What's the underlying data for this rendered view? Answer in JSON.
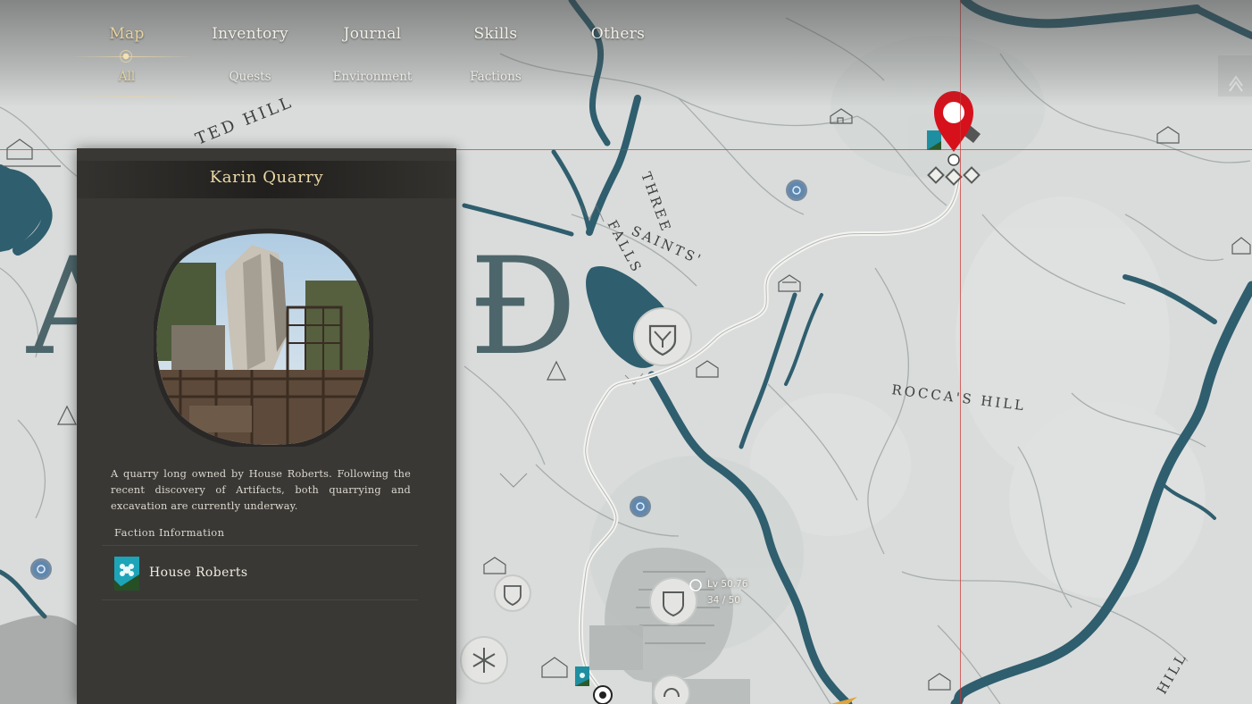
{
  "nav": {
    "tabs": [
      {
        "label": "Map",
        "active": true
      },
      {
        "label": "Inventory",
        "active": false
      },
      {
        "label": "Journal",
        "active": false
      },
      {
        "label": "Skills",
        "active": false
      },
      {
        "label": "Others",
        "active": false
      }
    ],
    "subtabs": [
      {
        "label": "All",
        "active": true
      },
      {
        "label": "Quests",
        "active": false
      },
      {
        "label": "Environment",
        "active": false
      },
      {
        "label": "Factions",
        "active": false
      }
    ]
  },
  "map_labels": {
    "hill_1": "TED HILL",
    "falls_1": "THREE",
    "falls_2": "SAINTS'",
    "falls_3": "FALLS",
    "roccas_hill": "ROCCA'S HILL",
    "hill_2": "HILL",
    "big_letter_left": "A",
    "big_letter_right": "Đ"
  },
  "panel": {
    "title": "Karin Quarry",
    "description": "A quarry long owned by House Roberts. Following the recent discovery of Artifacts, both quarrying and excavation are currently underway.",
    "faction_heading": "Faction Information",
    "faction_name": "House Roberts"
  },
  "level_badge": {
    "level": "Lv 50.76",
    "progress": "34 / 50"
  },
  "colors": {
    "map_bg": "#d9dcdb",
    "water": "#2f5e6e",
    "panel_bg": "#3a3835",
    "title_gold": "#ecd9a6",
    "pin_red": "#d6111c",
    "faction_teal": "#1da4b8"
  }
}
